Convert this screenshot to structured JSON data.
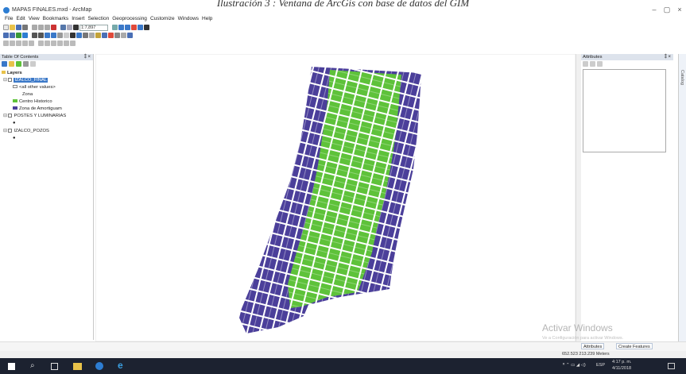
{
  "caption": "Ilustración 3 : Ventana de ArcGis con base de datos del GIM",
  "window": {
    "title": "MAPAS FINALES.mxd - ArcMap",
    "controls": [
      "–",
      "▢",
      "×"
    ]
  },
  "menu": [
    "File",
    "Edit",
    "View",
    "Bookmarks",
    "Insert",
    "Selection",
    "Geoprocessing",
    "Customize",
    "Windows",
    "Help"
  ],
  "toolbar": {
    "scale": "1:7,897"
  },
  "toc": {
    "title": "Table Of Contents",
    "root": "Layers",
    "layer1": "IZALCO_FINAL",
    "other_values": "<all other values>",
    "field": "Zona",
    "class1": "Centro Historico",
    "class2": "Zona de Amortiguam",
    "layer2": "POSTES Y LUMINARIAS",
    "layer3": "IZALCO_POZOS"
  },
  "attributes": {
    "title": "Attributes"
  },
  "catalog_tab": "Catalog",
  "bottom_tabs": [
    "Attributes",
    "Create Features"
  ],
  "watermark": {
    "line1": "Activar Windows",
    "line2": "Ve a Configuración para activar Windows."
  },
  "status": {
    "coords": "652.523  213.239 Meters"
  },
  "taskbar": {
    "time": "4:17 p. m.",
    "date": "4/11/2018",
    "lang": "ESP"
  },
  "colors": {
    "centro_historico": "#5ec23a",
    "zona_amortiguamiento": "#4b3f9a"
  }
}
